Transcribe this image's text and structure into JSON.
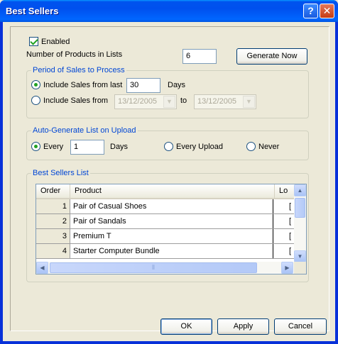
{
  "window": {
    "title": "Best Sellers",
    "help_label": "?",
    "close_label": "✕"
  },
  "enabled": {
    "label": "Enabled",
    "checked": true
  },
  "num_products": {
    "label": "Number of Products in Lists",
    "value": "6"
  },
  "generate_now_label": "Generate Now",
  "period": {
    "title": "Period of Sales to Process",
    "last_label": "Include Sales from last",
    "last_value": "30",
    "days_label": "Days",
    "from_label": "Include Sales from",
    "from_date": "13/12/2005",
    "to_label": "to",
    "to_date": "13/12/2005"
  },
  "autogen": {
    "title": "Auto-Generate List on Upload",
    "every_label": "Every",
    "every_value": "1",
    "days_label": "Days",
    "every_upload_label": "Every Upload",
    "never_label": "Never"
  },
  "best_sellers": {
    "title": "Best Sellers List",
    "columns": [
      "Order",
      "Product",
      "Lo"
    ],
    "rows": [
      {
        "order": "1",
        "product": "Pair of Casual Shoes",
        "lo": "["
      },
      {
        "order": "2",
        "product": "Pair of Sandals",
        "lo": "["
      },
      {
        "order": "3",
        "product": "Premium T",
        "lo": "["
      },
      {
        "order": "4",
        "product": "Starter Computer Bundle",
        "lo": "["
      }
    ]
  },
  "buttons": {
    "ok": "OK",
    "apply": "Apply",
    "cancel": "Cancel"
  },
  "icons": {
    "scroll_up": "▲",
    "scroll_down": "▼",
    "scroll_left": "◀",
    "scroll_right": "▶",
    "dropdown": "▼",
    "grip": "⦀"
  },
  "colors": {
    "title_bar": "#0053EE",
    "group_title": "#0046D5",
    "check_mark": "#21A121",
    "dialog_bg": "#ECE9D8"
  }
}
